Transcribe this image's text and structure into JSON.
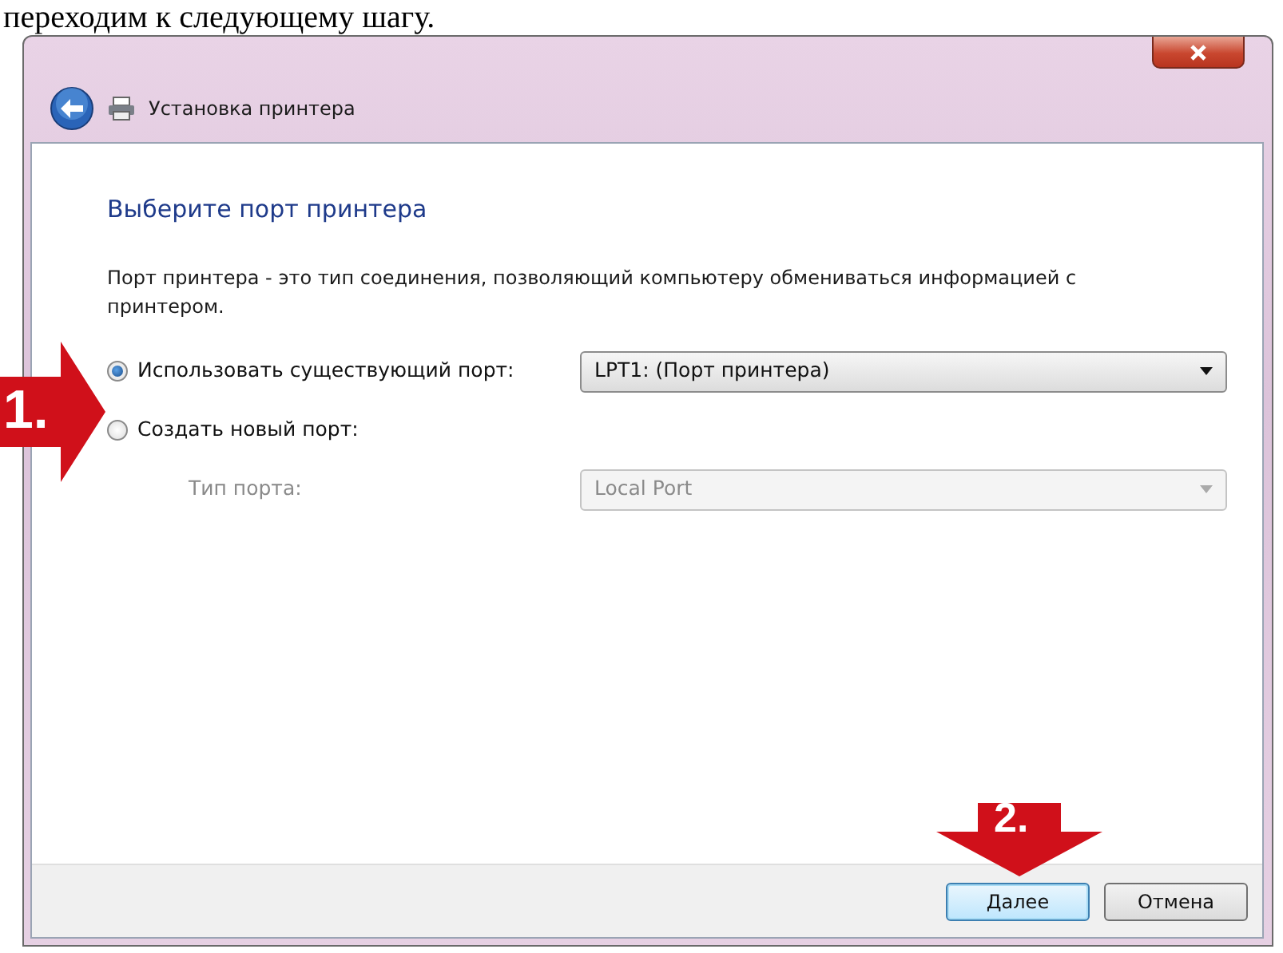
{
  "caption": "переходим к следующему шагу.",
  "window": {
    "title": "Установка принтера"
  },
  "heading": "Выберите порт принтера",
  "description": "Порт принтера - это тип соединения, позволяющий компьютеру обмениваться информацией с принтером.",
  "rows": [
    {
      "kind": "radio",
      "label": "Использовать существующий порт:",
      "selected": true,
      "dropdown": {
        "value": "LPT1: (Порт принтера)",
        "disabled": false
      }
    },
    {
      "kind": "radio",
      "label": "Создать новый порт:",
      "selected": false
    },
    {
      "kind": "label",
      "label": "Тип порта:",
      "dropdown": {
        "value": "Local Port",
        "disabled": true
      }
    }
  ],
  "buttons": [
    {
      "label": "Далее",
      "default": true
    },
    {
      "label": "Отмена",
      "default": false
    }
  ],
  "annotations": [
    {
      "label": "1.",
      "kind": "right"
    },
    {
      "label": "2.",
      "kind": "down"
    }
  ]
}
